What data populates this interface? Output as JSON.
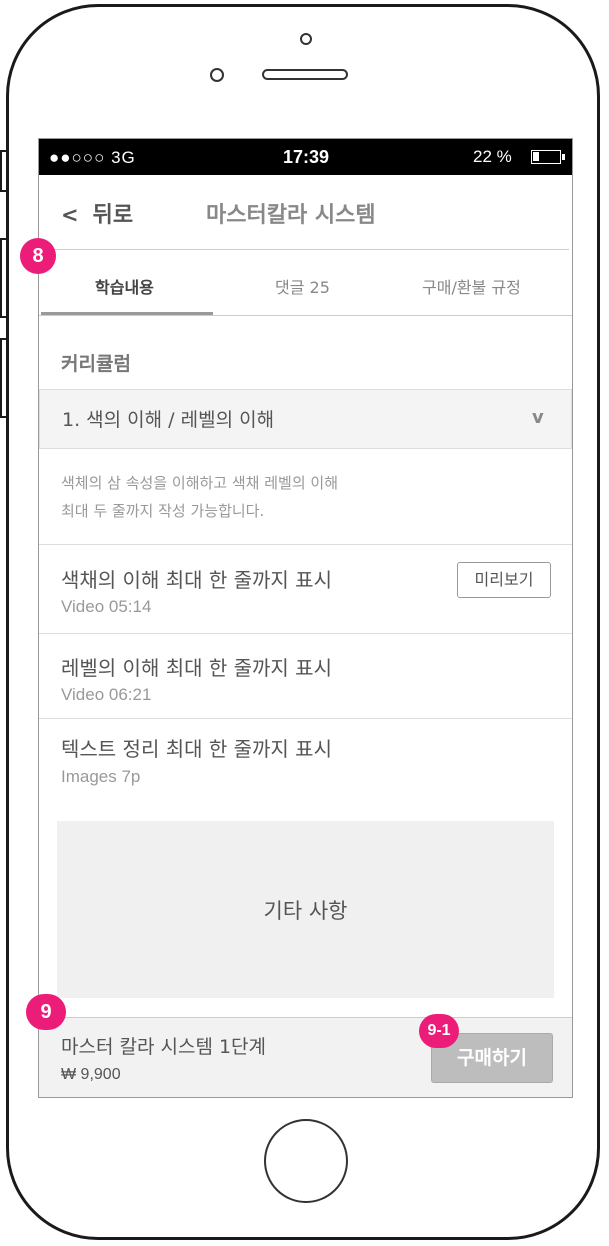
{
  "status_bar": {
    "signal": "●●○○○ 3G",
    "time": "17:39",
    "battery_text": "22 %",
    "battery_level": 0.22
  },
  "header": {
    "back_label": "뒤로",
    "title": "마스터칼라 시스템"
  },
  "tabs": [
    {
      "label": "학습내용",
      "active": true
    },
    {
      "label": "댓글 25",
      "active": false
    },
    {
      "label": "구매/환불 규정",
      "active": false
    }
  ],
  "curriculum": {
    "label": "커리큘럼",
    "chapter_title": "1.  색의 이해 / 레벨의 이해",
    "chevron": "v",
    "description_lines": [
      "색체의 삼 속성을 이해하고 색채 레벨의 이해",
      "최대 두 줄까지 작성 가능합니다."
    ],
    "lessons": [
      {
        "title": "색채의 이해 최대 한 줄까지 표시",
        "meta": "Video 05:14",
        "preview": "미리보기"
      },
      {
        "title": "레벨의 이해 최대 한 줄까지 표시",
        "meta": "Video 06:21"
      },
      {
        "title": "텍스트 정리 최대 한 줄까지 표시",
        "meta": "Images 7p"
      }
    ]
  },
  "etc": {
    "label": "기타 사항"
  },
  "purchase": {
    "product_name": "마스터 칼라 시스템 1단계",
    "price": "₩ 9,900",
    "buy_label": "구매하기"
  },
  "annotations": {
    "badge_8": "8",
    "badge_9": "9",
    "badge_9_1": "9-1"
  },
  "colors": {
    "annotation": "#ec1c79",
    "buy_button": "#bdbdbd"
  }
}
